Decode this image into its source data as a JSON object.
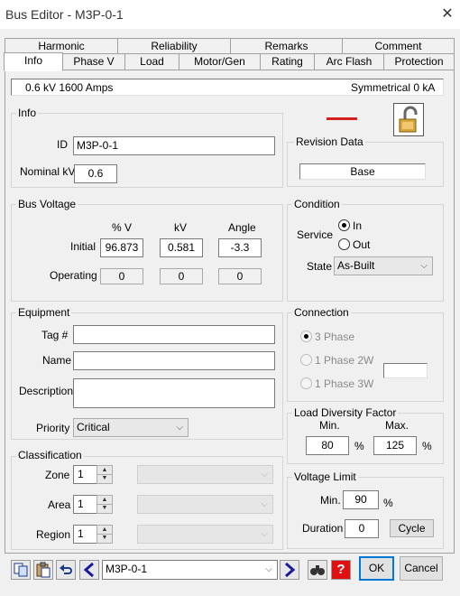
{
  "window": {
    "title": "Bus Editor - M3P-0-1",
    "close_glyph": "✕"
  },
  "tabs_row2": [
    "Harmonic",
    "Reliability",
    "Remarks",
    "Comment"
  ],
  "tabs_row1": [
    "Info",
    "Phase V",
    "Load",
    "Motor/Gen",
    "Rating",
    "Arc Flash",
    "Protection"
  ],
  "summary": {
    "left": "0.6 kV  1600 Amps",
    "right": "Symmetrical  0 kA"
  },
  "info": {
    "legend": "Info",
    "id_label": "ID",
    "id_value": "M3P-0-1",
    "nominal_kv_label": "Nominal kV",
    "nominal_kv_value": "0.6"
  },
  "revision": {
    "legend": "Revision Data",
    "value": "Base"
  },
  "bus_voltage": {
    "legend": "Bus Voltage",
    "col_pct_v": "% V",
    "col_kv": "kV",
    "col_angle": "Angle",
    "initial_label": "Initial",
    "operating_label": "Operating",
    "initial": {
      "pct_v": "96.873",
      "kv": "0.581",
      "angle": "-3.3"
    },
    "operating": {
      "pct_v": "0",
      "kv": "0",
      "angle": "0"
    }
  },
  "condition": {
    "legend": "Condition",
    "service_label": "Service",
    "in_label": "In",
    "out_label": "Out",
    "service_selected": "In",
    "state_label": "State",
    "state_value": "As-Built"
  },
  "equipment": {
    "legend": "Equipment",
    "tag_label": "Tag #",
    "tag_value": "",
    "name_label": "Name",
    "name_value": "",
    "description_label": "Description",
    "description_value": "",
    "priority_label": "Priority",
    "priority_value": "Critical"
  },
  "connection": {
    "legend": "Connection",
    "options": [
      "3 Phase",
      "1 Phase 2W",
      "1 Phase 3W"
    ],
    "selected": "3 Phase",
    "extra_value": ""
  },
  "classification": {
    "legend": "Classification",
    "zone_label": "Zone",
    "zone_value": "1",
    "area_label": "Area",
    "area_value": "1",
    "region_label": "Region",
    "region_value": "1"
  },
  "load_diversity": {
    "legend": "Load Diversity Factor",
    "min_label": "Min.",
    "max_label": "Max.",
    "min_value": "80",
    "max_value": "125",
    "unit": "%"
  },
  "voltage_limit": {
    "legend": "Voltage Limit",
    "min_label": "Min.",
    "min_value": "90",
    "unit": "%",
    "duration_label": "Duration",
    "duration_value": "0",
    "cycle_button": "Cycle"
  },
  "footer": {
    "element_value": "M3P-0-1",
    "ok": "OK",
    "cancel": "Cancel",
    "help_glyph": "?"
  },
  "colors": {
    "accent": "#0078d7",
    "red_marker": "#d42020",
    "help_red": "#e01010",
    "nav_blue": "#1a1aa0"
  },
  "icons": [
    "close-icon",
    "lock-icon",
    "copy-icon",
    "paste-icon",
    "undo-icon",
    "prev-icon",
    "next-icon",
    "find-icon",
    "help-icon"
  ]
}
